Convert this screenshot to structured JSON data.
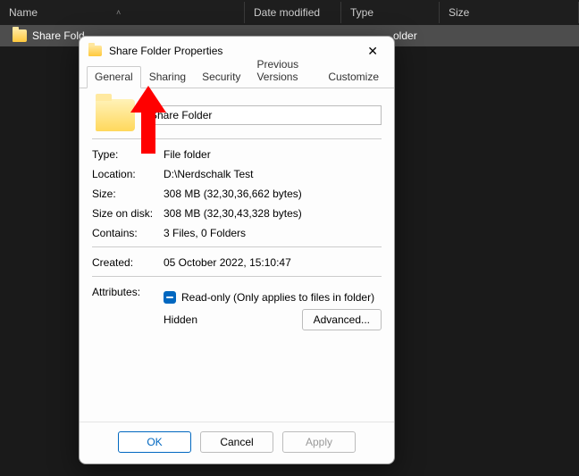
{
  "explorer": {
    "columns": {
      "name": "Name",
      "date": "Date modified",
      "type": "Type",
      "size": "Size"
    },
    "row": {
      "name": "Share Fold",
      "type": "older"
    }
  },
  "dialog": {
    "title": "Share Folder Properties",
    "tabs": {
      "general": "General",
      "sharing": "Sharing",
      "security": "Security",
      "previous": "Previous Versions",
      "customize": "Customize"
    },
    "folder_name": "Share Folder",
    "labels": {
      "type": "Type:",
      "location": "Location:",
      "size": "Size:",
      "size_on_disk": "Size on disk:",
      "contains": "Contains:",
      "created": "Created:",
      "attributes": "Attributes:"
    },
    "values": {
      "type": "File folder",
      "location": "D:\\Nerdschalk Test",
      "size": "308 MB (32,30,36,662 bytes)",
      "size_on_disk": "308 MB (32,30,43,328 bytes)",
      "contains": "3 Files, 0 Folders",
      "created": "05 October 2022, 15:10:47"
    },
    "readonly_label": "Read-only (Only applies to files in folder)",
    "hidden_label": "Hidden",
    "advanced_label": "Advanced...",
    "buttons": {
      "ok": "OK",
      "cancel": "Cancel",
      "apply": "Apply"
    }
  }
}
